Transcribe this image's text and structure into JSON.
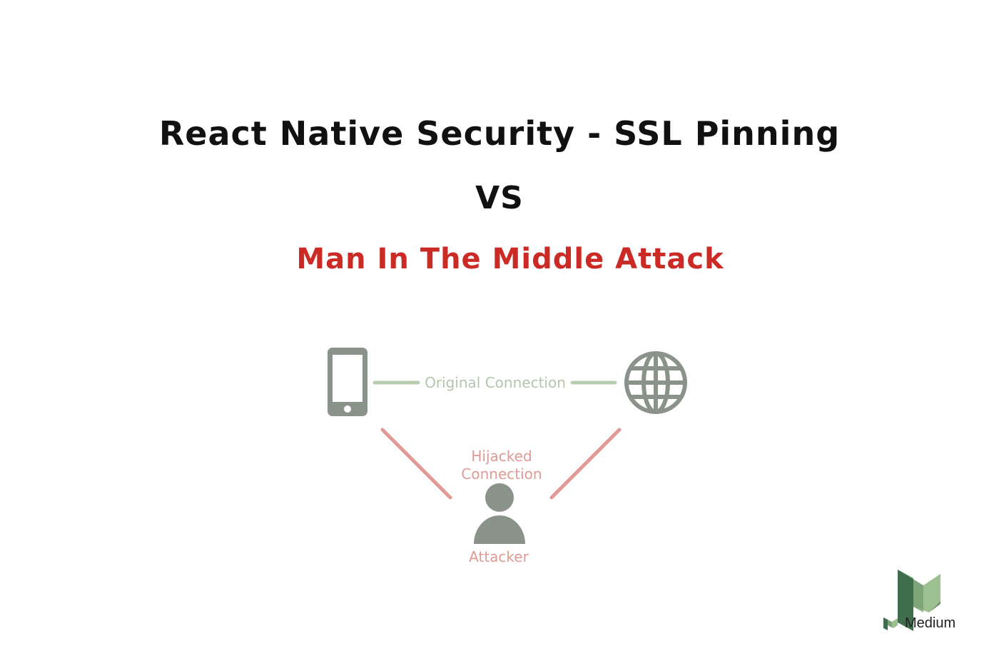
{
  "header": {
    "title": "React Native Security - SSL Pinning",
    "vs": "VS",
    "subtitle": "Man In The Middle Attack"
  },
  "diagram": {
    "original_connection_label": "Original Connection",
    "hijacked_connection_label_line1": "Hijacked",
    "hijacked_connection_label_line2": "Connection",
    "attacker_label": "Attacker",
    "nodes": {
      "client_icon": "smartphone-icon",
      "server_icon": "globe-icon",
      "attacker_icon": "user-icon"
    },
    "colors": {
      "icon_gray": "#8a9389",
      "original_line_green": "#b8ccb0",
      "hijack_line_red": "#e39a97",
      "hijack_text": "#e09a95",
      "title_red": "#cc2a25"
    }
  },
  "branding": {
    "logo_icon": "medium-logo-icon",
    "wordmark": "Medium"
  }
}
